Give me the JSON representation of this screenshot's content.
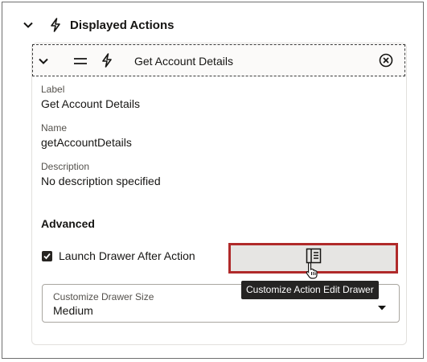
{
  "section": {
    "title": "Displayed Actions",
    "chevron_icon": "chevron-down-icon",
    "bolt_icon": "lightning-bolt-icon"
  },
  "action": {
    "title": "Get Account Details",
    "icons": [
      "chevron-down-icon",
      "drag-handle-icon",
      "lightning-bolt-icon",
      "remove-circle-icon"
    ]
  },
  "fields": {
    "label": {
      "label": "Label",
      "value": "Get Account Details"
    },
    "name": {
      "label": "Name",
      "value": "getAccountDetails"
    },
    "description": {
      "label": "Description",
      "value": "No description specified"
    }
  },
  "advanced": {
    "title": "Advanced",
    "launch_drawer": {
      "label": "Launch Drawer After Action",
      "checked": true
    },
    "customize_button_icon": "drawer-panel-icon",
    "drawer_size": {
      "label": "Customize Drawer Size",
      "value": "Medium"
    },
    "tooltip": "Customize Action Edit Drawer"
  },
  "colors": {
    "highlight_border": "#b02a2a",
    "tooltip_bg": "#252423"
  }
}
